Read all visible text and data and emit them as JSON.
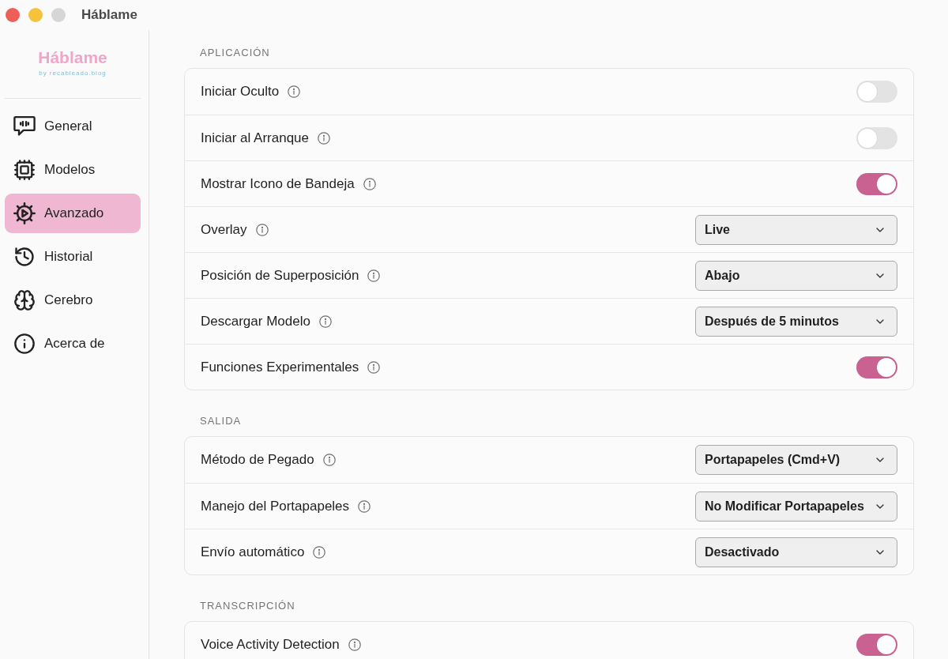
{
  "window": {
    "title": "Háblame"
  },
  "sidebar": {
    "logo": {
      "title": "Háblame",
      "subtitle": "by recableado.blog"
    },
    "items": [
      {
        "label": "General",
        "selected": false
      },
      {
        "label": "Modelos",
        "selected": false
      },
      {
        "label": "Avanzado",
        "selected": true
      },
      {
        "label": "Historial",
        "selected": false
      },
      {
        "label": "Cerebro",
        "selected": false
      },
      {
        "label": "Acerca de",
        "selected": false
      }
    ]
  },
  "sections": [
    {
      "title": "APLICACIÓN",
      "rows": [
        {
          "kind": "toggle",
          "label": "Iniciar Oculto",
          "on": false
        },
        {
          "kind": "toggle",
          "label": "Iniciar al Arranque",
          "on": false
        },
        {
          "kind": "toggle",
          "label": "Mostrar Icono de Bandeja",
          "on": true
        },
        {
          "kind": "select",
          "label": "Overlay",
          "value": "Live"
        },
        {
          "kind": "select",
          "label": "Posición de Superposición",
          "value": "Abajo"
        },
        {
          "kind": "select",
          "label": "Descargar Modelo",
          "value": "Después de 5 minutos"
        },
        {
          "kind": "toggle",
          "label": "Funciones Experimentales",
          "on": true
        }
      ]
    },
    {
      "title": "SALIDA",
      "rows": [
        {
          "kind": "select",
          "label": "Método de Pegado",
          "value": "Portapapeles (Cmd+V)"
        },
        {
          "kind": "select",
          "label": "Manejo del Portapapeles",
          "value": "No Modificar Portapapeles"
        },
        {
          "kind": "select",
          "label": "Envío automático",
          "value": "Desactivado"
        }
      ]
    },
    {
      "title": "TRANSCRIPCIÓN",
      "rows": [
        {
          "kind": "toggle",
          "label": "Voice Activity Detection",
          "on": true
        }
      ]
    }
  ]
}
